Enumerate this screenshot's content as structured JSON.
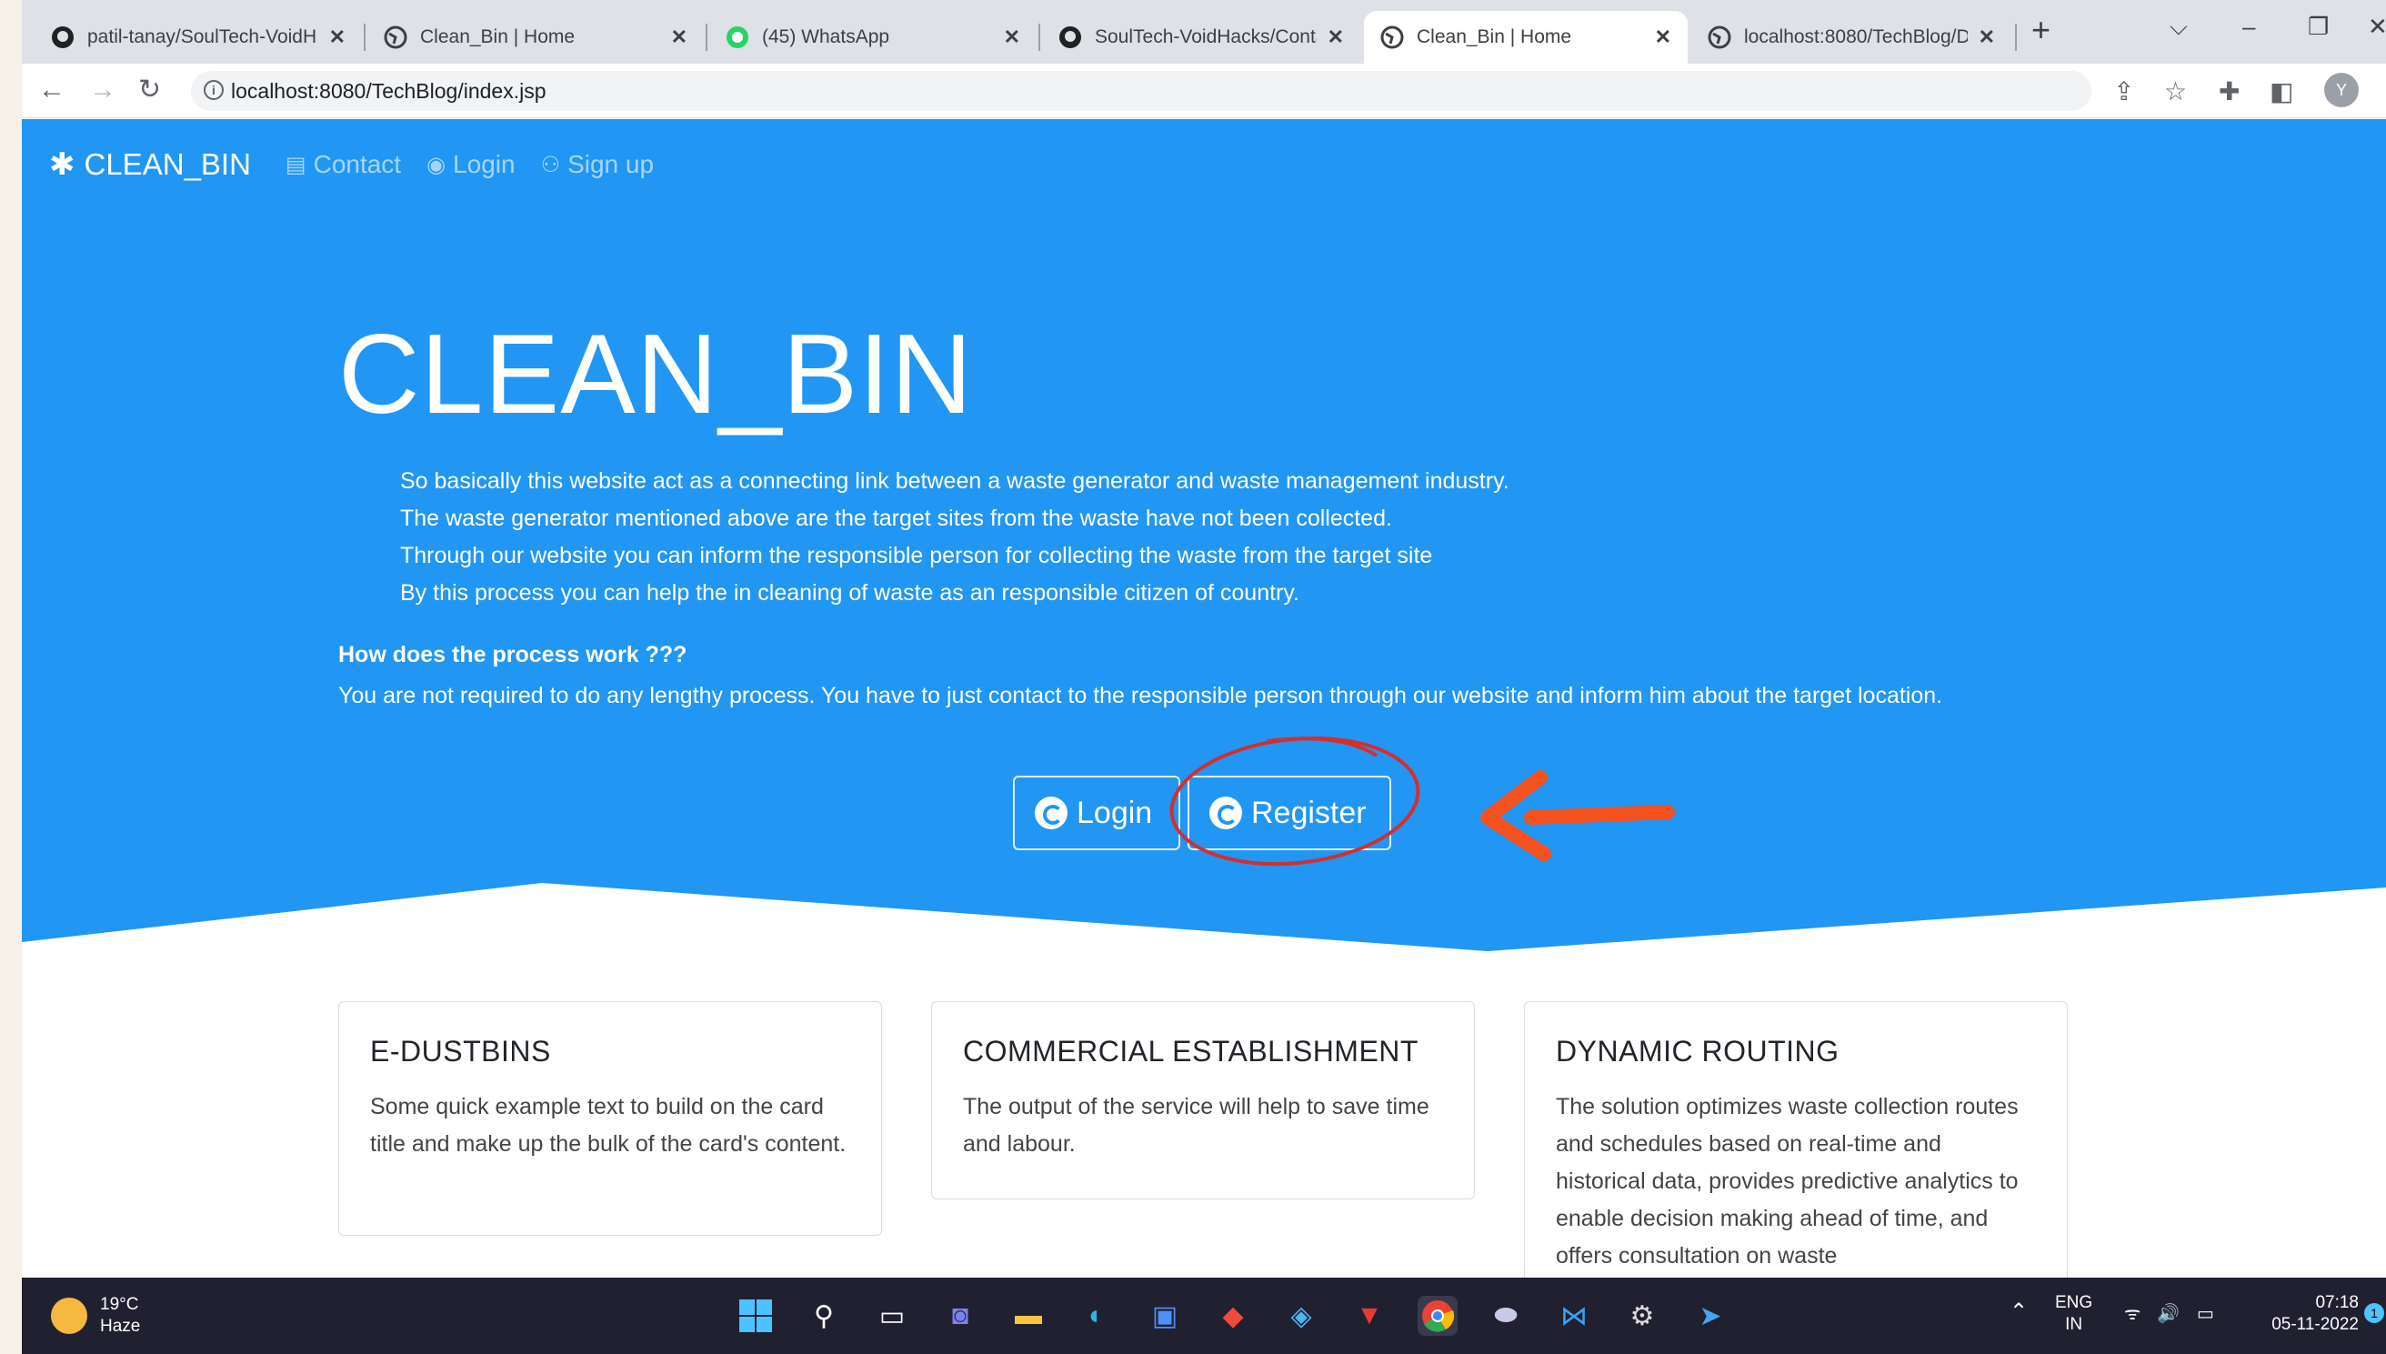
{
  "browser": {
    "tabs": [
      {
        "title": "patil-tanay/SoulTech-VoidH",
        "icon": "github-icon"
      },
      {
        "title": "Clean_Bin | Home",
        "icon": "globe-icon"
      },
      {
        "title": "(45) WhatsApp",
        "icon": "whatsapp-icon"
      },
      {
        "title": "SoulTech-VoidHacks/Conta",
        "icon": "github-icon"
      },
      {
        "title": "Clean_Bin | Home",
        "icon": "globe-icon",
        "active": true
      },
      {
        "title": "localhost:8080/TechBlog/D",
        "icon": "globe-icon"
      }
    ],
    "url": "localhost:8080/TechBlog/index.jsp",
    "profile_initial": "Y"
  },
  "navbar": {
    "brand": "CLEAN_BIN",
    "links": [
      "Contact",
      "Login",
      "Sign up"
    ]
  },
  "hero": {
    "title": "CLEAN_BIN",
    "intro": [
      "So basically this website act as a connecting link between a waste generator and waste management industry.",
      "The waste generator mentioned above are the target sites from the waste have not been collected.",
      "Through our website you can inform the responsible person for collecting the waste from the target site",
      "By this process you can help the in cleaning of waste as an responsible citizen of country."
    ],
    "howto_heading": "How does the process work ???",
    "howto_text": "You are not required to do any lengthy process. You have to just contact to the responsible person through our website and inform him about the target location.",
    "login_button": "Login",
    "register_button": "Register"
  },
  "annotation": {
    "circle_color": "#d32f2f",
    "arrow_color": "#f4511e"
  },
  "cards": [
    {
      "title": "E-DUSTBINS",
      "text": "Some quick example text to build on the card title and make up the bulk of the card's content."
    },
    {
      "title": "COMMERCIAL ESTABLISHMENT",
      "text": "The output of the service will help to save time and labour."
    },
    {
      "title": "DYNAMIC ROUTING",
      "text": "The solution optimizes waste collection routes and schedules based on real-time and historical data, provides predictive analytics to enable decision making ahead of time, and offers consultation on waste"
    }
  ],
  "taskbar": {
    "weather_temp": "19°C",
    "weather_desc": "Haze",
    "lang_1": "ENG",
    "lang_2": "IN",
    "time": "07:18",
    "date": "05-11-2022",
    "notification_count": "1"
  },
  "colors": {
    "hero_bg": "#2196f3",
    "taskbar_bg": "#202030"
  }
}
